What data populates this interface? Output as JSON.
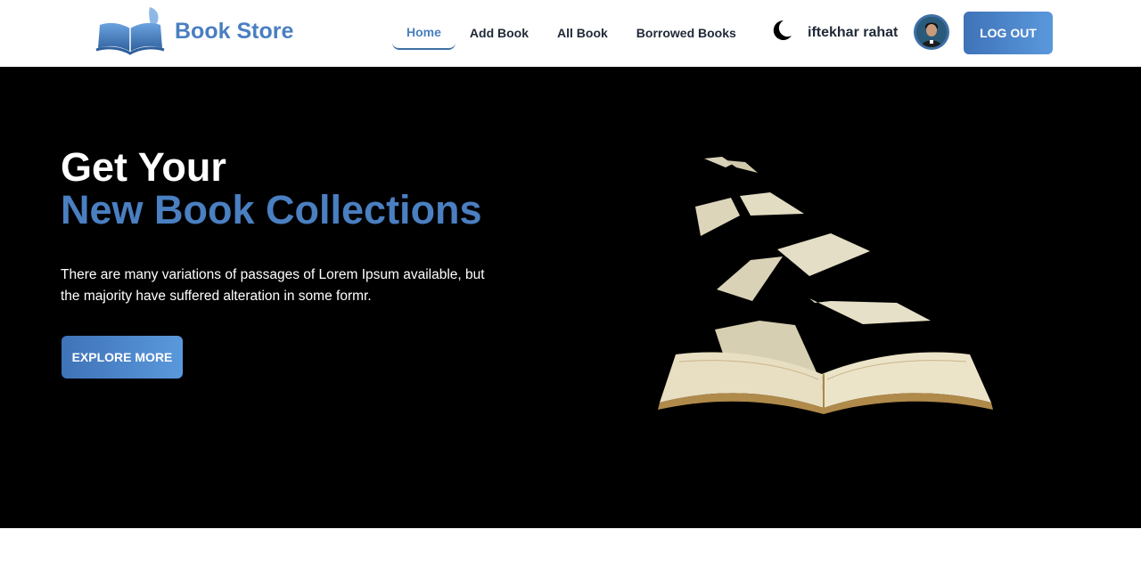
{
  "brand": {
    "name": "Book Store",
    "logo_icon": "open-book-quill-logo"
  },
  "nav": {
    "items": [
      {
        "label": "Home",
        "active": true
      },
      {
        "label": "Add Book",
        "active": false
      },
      {
        "label": "All Book",
        "active": false
      },
      {
        "label": "Borrowed Books",
        "active": false
      }
    ]
  },
  "theme_toggle": {
    "icon": "moon-icon"
  },
  "user": {
    "name": "iftekhar rahat"
  },
  "logout_label": "LOG OUT",
  "hero": {
    "title_line1": "Get Your",
    "title_line2": "New Book Collections",
    "description": "There are many variations of passages of Lorem Ipsum available, but the majority have suffered alteration in some formr.",
    "cta_label": "EXPLORE MORE",
    "image": "flying-book-pages-illustration"
  },
  "colors": {
    "accent": "#4a7fc1",
    "accent_dark": "#3f6fa6",
    "hero_bg": "#000000",
    "page_bg": "#ffffff"
  }
}
